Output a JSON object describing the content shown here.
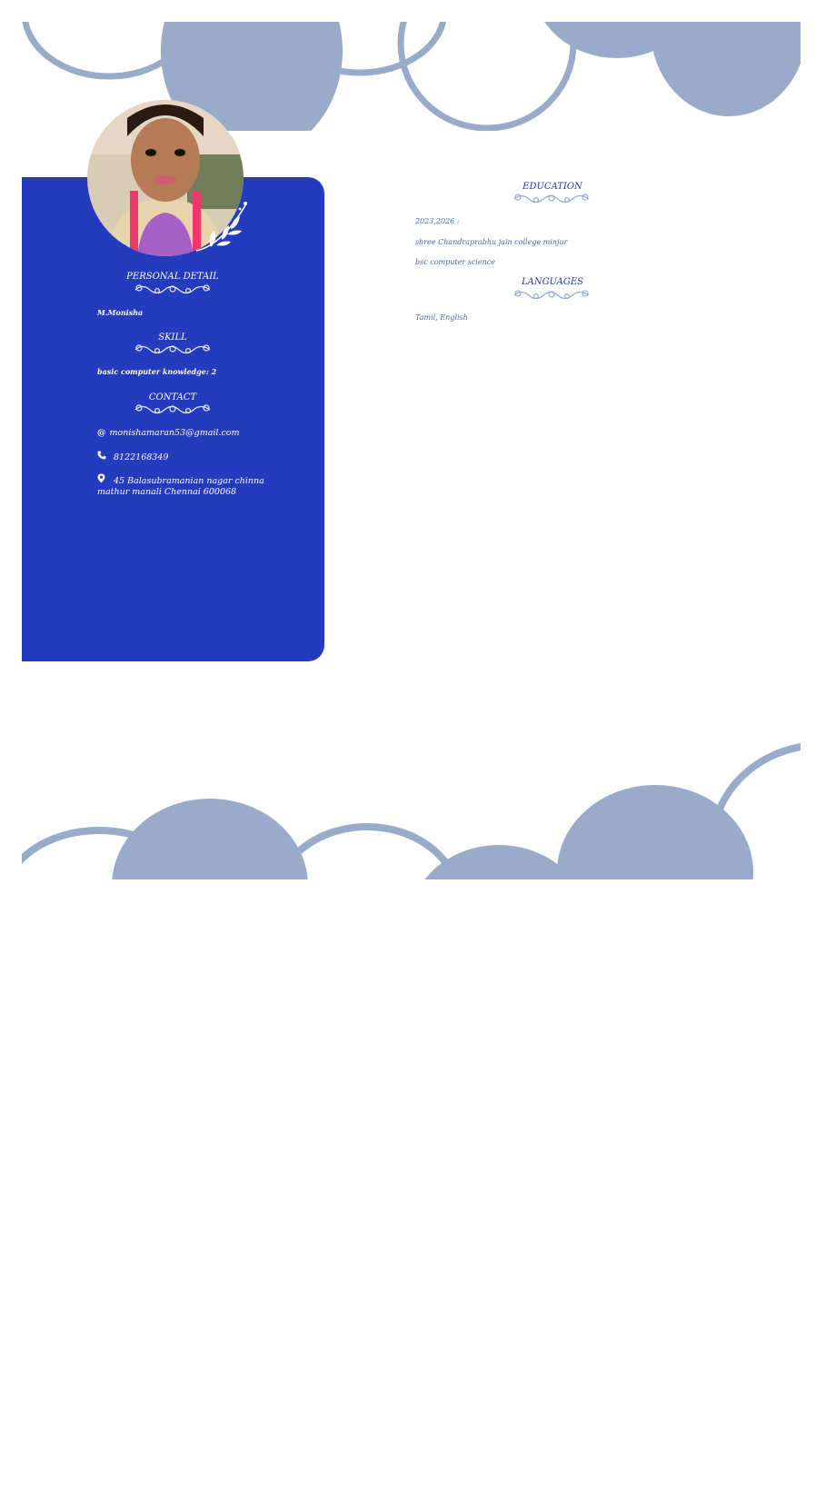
{
  "colors": {
    "sidebar": "#243bbd",
    "decor": "#98abc8",
    "heading_main": "#2537b0",
    "text_main": "#4a6ba3",
    "text_sidebar": "#ffffff"
  },
  "profile": {
    "photo_alt": "profile photo"
  },
  "sidebar": {
    "personal_heading": "PERSONAL DETAIL",
    "name": "M.Monisha",
    "skill_heading": "SKILL",
    "skill_item": "basic computer knowledge: 2",
    "contact_heading": "CONTACT",
    "email_icon": "@",
    "email": "monishamaran53@gmail.com",
    "phone_icon_name": "phone-icon",
    "phone": "8122168349",
    "location_icon_name": "location-pin-icon",
    "address": "45 Balasubramanian nagar chinna mathur manali Chennai 600068"
  },
  "main": {
    "education_heading": "EDUCATION",
    "education_period": "2023,2026 :",
    "education_college": "shree Chandraprabhu jain college minjur",
    "education_course": "bsc computer science",
    "languages_heading": "LANGUAGES",
    "languages": "Tamil, English"
  }
}
